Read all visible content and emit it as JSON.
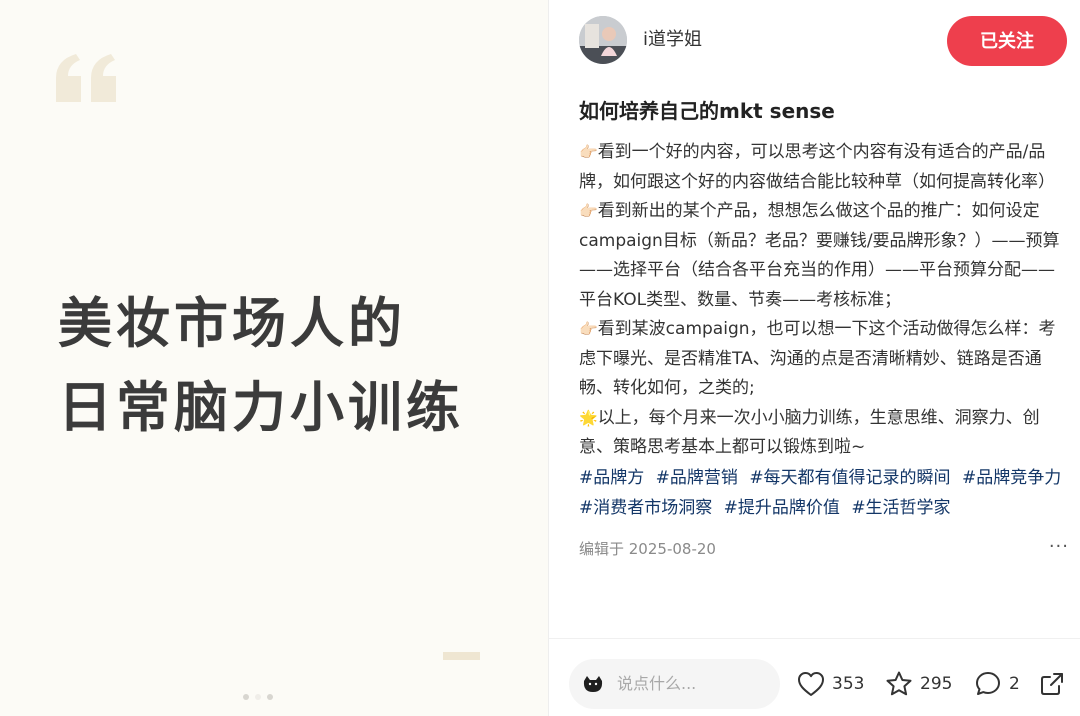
{
  "cover": {
    "title_line1": "美妆市场人的",
    "title_line2": "日常脑力小训练",
    "quote_icon": "quote-icon",
    "carousel_pages": 3,
    "carousel_active": 1
  },
  "author": {
    "name": "i道学姐",
    "follow_label": "已关注"
  },
  "note": {
    "title": "如何培养自己的mkt sense",
    "emoji_point": "👉🏻",
    "emoji_sparkle": "🌟",
    "para1": "看到一个好的内容，可以思考这个内容有没有适合的产品/品牌，如何跟这个好的内容做结合能比较种草（如何提高转化率）",
    "para2": "看到新出的某个产品，想想怎么做这个品的推广：如何设定campaign目标（新品？老品？要赚钱/要品牌形象？）——预算——选择平台（结合各平台充当的作用）——平台预算分配——平台KOL类型、数量、节奏——考核标准；",
    "para3": "看到某波campaign，也可以想一下这个活动做得怎么样：考虑下曝光、是否精准TA、沟通的点是否清晰精妙、链路是否通畅、转化如何，之类的;",
    "para4": "以上，每个月来一次小小脑力训练，生意思维、洞察力、创意、策略思考基本上都可以锻炼到啦~",
    "tags": [
      "#品牌方",
      "#品牌营销",
      "#每天都有值得记录的瞬间",
      "#品牌竞争力",
      "#消费者市场洞察",
      "#提升品牌价值",
      "#生活哲学家"
    ],
    "edit_date": "编辑于 2025-08-20",
    "more_label": "···"
  },
  "bottom_bar": {
    "comment_placeholder": "说点什么...",
    "like_count": "353",
    "collect_count": "295",
    "comment_count": "2"
  },
  "colors": {
    "accent": "#ee3f4d",
    "tag": "#133667",
    "cover_bg": "#fcfbf6",
    "cover_text": "#3b3b3b"
  }
}
